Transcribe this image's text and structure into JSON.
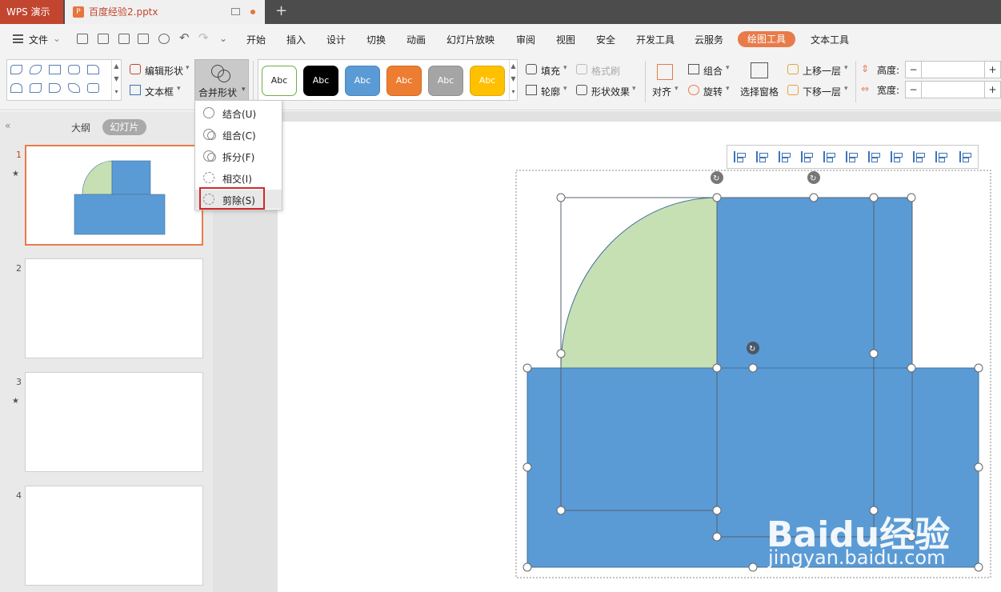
{
  "titlebar": {
    "app_name": "WPS 演示",
    "doc_name": "百度经验2.pptx",
    "doc_icon": "P",
    "new_tab": "+"
  },
  "menu": {
    "file": "文件",
    "items": [
      "开始",
      "插入",
      "设计",
      "切换",
      "动画",
      "幻灯片放映",
      "审阅",
      "视图",
      "安全",
      "开发工具",
      "云服务"
    ],
    "active_tab": "绘图工具",
    "text_tool": "文本工具"
  },
  "ribbon": {
    "edit_shape": "编辑形状",
    "text_box": "文本框",
    "merge_shape": "合并形状",
    "styles": [
      {
        "label": "Abc",
        "bg": "#ffffff",
        "fg": "#222222",
        "border": "#70ad47"
      },
      {
        "label": "Abc",
        "bg": "#000000",
        "fg": "#ffffff",
        "border": "#000000"
      },
      {
        "label": "Abc",
        "bg": "#5b9bd5",
        "fg": "#ffffff",
        "border": "#4a86bf"
      },
      {
        "label": "Abc",
        "bg": "#ed7d31",
        "fg": "#ffffff",
        "border": "#d46a22"
      },
      {
        "label": "Abc",
        "bg": "#a5a5a5",
        "fg": "#ffffff",
        "border": "#8f8f8f"
      },
      {
        "label": "Abc",
        "bg": "#ffc000",
        "fg": "#ffffff",
        "border": "#e0a800"
      }
    ],
    "fill": "填充",
    "outline": "轮廓",
    "format_painter": "格式刷",
    "shape_effects": "形状效果",
    "align": "对齐",
    "group": "组合",
    "rotate": "旋转",
    "selection_pane": "选择窗格",
    "bring_forward": "上移一层",
    "send_backward": "下移一层",
    "height_label": "高度:",
    "width_label": "宽度:",
    "minus": "−",
    "plus": "+"
  },
  "merge_menu": {
    "items": [
      "结合(U)",
      "组合(C)",
      "拆分(F)",
      "相交(I)",
      "剪除(S)"
    ],
    "highlighted": "剪除(S)"
  },
  "slides_panel": {
    "tab_outline": "大纲",
    "tab_slides": "幻灯片",
    "collapse": "«",
    "slides": [
      {
        "num": "1",
        "star": "★"
      },
      {
        "num": "2",
        "star": ""
      },
      {
        "num": "3",
        "star": "★"
      },
      {
        "num": "4",
        "star": ""
      }
    ]
  },
  "canvas": {
    "colors": {
      "blue": "#5b9bd5",
      "green": "#c6e0b4",
      "outline": "#41719c"
    }
  },
  "watermark": {
    "brand": "Baidu经验",
    "url": "jingyan.baidu.com"
  }
}
